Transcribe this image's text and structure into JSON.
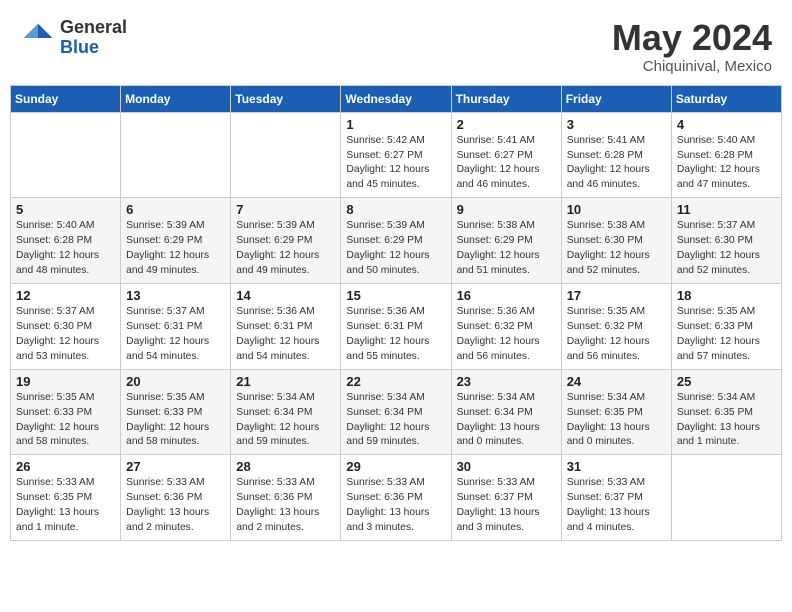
{
  "header": {
    "logo_general": "General",
    "logo_blue": "Blue",
    "month_year": "May 2024",
    "location": "Chiquinival, Mexico"
  },
  "days_of_week": [
    "Sunday",
    "Monday",
    "Tuesday",
    "Wednesday",
    "Thursday",
    "Friday",
    "Saturday"
  ],
  "weeks": [
    [
      {
        "day": "",
        "info": ""
      },
      {
        "day": "",
        "info": ""
      },
      {
        "day": "",
        "info": ""
      },
      {
        "day": "1",
        "info": "Sunrise: 5:42 AM\nSunset: 6:27 PM\nDaylight: 12 hours\nand 45 minutes."
      },
      {
        "day": "2",
        "info": "Sunrise: 5:41 AM\nSunset: 6:27 PM\nDaylight: 12 hours\nand 46 minutes."
      },
      {
        "day": "3",
        "info": "Sunrise: 5:41 AM\nSunset: 6:28 PM\nDaylight: 12 hours\nand 46 minutes."
      },
      {
        "day": "4",
        "info": "Sunrise: 5:40 AM\nSunset: 6:28 PM\nDaylight: 12 hours\nand 47 minutes."
      }
    ],
    [
      {
        "day": "5",
        "info": "Sunrise: 5:40 AM\nSunset: 6:28 PM\nDaylight: 12 hours\nand 48 minutes."
      },
      {
        "day": "6",
        "info": "Sunrise: 5:39 AM\nSunset: 6:29 PM\nDaylight: 12 hours\nand 49 minutes."
      },
      {
        "day": "7",
        "info": "Sunrise: 5:39 AM\nSunset: 6:29 PM\nDaylight: 12 hours\nand 49 minutes."
      },
      {
        "day": "8",
        "info": "Sunrise: 5:39 AM\nSunset: 6:29 PM\nDaylight: 12 hours\nand 50 minutes."
      },
      {
        "day": "9",
        "info": "Sunrise: 5:38 AM\nSunset: 6:29 PM\nDaylight: 12 hours\nand 51 minutes."
      },
      {
        "day": "10",
        "info": "Sunrise: 5:38 AM\nSunset: 6:30 PM\nDaylight: 12 hours\nand 52 minutes."
      },
      {
        "day": "11",
        "info": "Sunrise: 5:37 AM\nSunset: 6:30 PM\nDaylight: 12 hours\nand 52 minutes."
      }
    ],
    [
      {
        "day": "12",
        "info": "Sunrise: 5:37 AM\nSunset: 6:30 PM\nDaylight: 12 hours\nand 53 minutes."
      },
      {
        "day": "13",
        "info": "Sunrise: 5:37 AM\nSunset: 6:31 PM\nDaylight: 12 hours\nand 54 minutes."
      },
      {
        "day": "14",
        "info": "Sunrise: 5:36 AM\nSunset: 6:31 PM\nDaylight: 12 hours\nand 54 minutes."
      },
      {
        "day": "15",
        "info": "Sunrise: 5:36 AM\nSunset: 6:31 PM\nDaylight: 12 hours\nand 55 minutes."
      },
      {
        "day": "16",
        "info": "Sunrise: 5:36 AM\nSunset: 6:32 PM\nDaylight: 12 hours\nand 56 minutes."
      },
      {
        "day": "17",
        "info": "Sunrise: 5:35 AM\nSunset: 6:32 PM\nDaylight: 12 hours\nand 56 minutes."
      },
      {
        "day": "18",
        "info": "Sunrise: 5:35 AM\nSunset: 6:33 PM\nDaylight: 12 hours\nand 57 minutes."
      }
    ],
    [
      {
        "day": "19",
        "info": "Sunrise: 5:35 AM\nSunset: 6:33 PM\nDaylight: 12 hours\nand 58 minutes."
      },
      {
        "day": "20",
        "info": "Sunrise: 5:35 AM\nSunset: 6:33 PM\nDaylight: 12 hours\nand 58 minutes."
      },
      {
        "day": "21",
        "info": "Sunrise: 5:34 AM\nSunset: 6:34 PM\nDaylight: 12 hours\nand 59 minutes."
      },
      {
        "day": "22",
        "info": "Sunrise: 5:34 AM\nSunset: 6:34 PM\nDaylight: 12 hours\nand 59 minutes."
      },
      {
        "day": "23",
        "info": "Sunrise: 5:34 AM\nSunset: 6:34 PM\nDaylight: 13 hours\nand 0 minutes."
      },
      {
        "day": "24",
        "info": "Sunrise: 5:34 AM\nSunset: 6:35 PM\nDaylight: 13 hours\nand 0 minutes."
      },
      {
        "day": "25",
        "info": "Sunrise: 5:34 AM\nSunset: 6:35 PM\nDaylight: 13 hours\nand 1 minute."
      }
    ],
    [
      {
        "day": "26",
        "info": "Sunrise: 5:33 AM\nSunset: 6:35 PM\nDaylight: 13 hours\nand 1 minute."
      },
      {
        "day": "27",
        "info": "Sunrise: 5:33 AM\nSunset: 6:36 PM\nDaylight: 13 hours\nand 2 minutes."
      },
      {
        "day": "28",
        "info": "Sunrise: 5:33 AM\nSunset: 6:36 PM\nDaylight: 13 hours\nand 2 minutes."
      },
      {
        "day": "29",
        "info": "Sunrise: 5:33 AM\nSunset: 6:36 PM\nDaylight: 13 hours\nand 3 minutes."
      },
      {
        "day": "30",
        "info": "Sunrise: 5:33 AM\nSunset: 6:37 PM\nDaylight: 13 hours\nand 3 minutes."
      },
      {
        "day": "31",
        "info": "Sunrise: 5:33 AM\nSunset: 6:37 PM\nDaylight: 13 hours\nand 4 minutes."
      },
      {
        "day": "",
        "info": ""
      }
    ]
  ]
}
